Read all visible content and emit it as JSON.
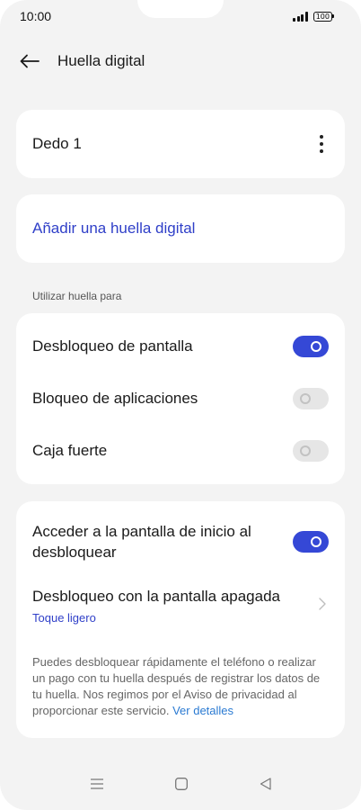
{
  "status_bar": {
    "time": "10:00",
    "battery": "100"
  },
  "header": {
    "title": "Huella digital"
  },
  "finger": {
    "label": "Dedo 1"
  },
  "add": {
    "label": "Añadir una huella digital"
  },
  "use_section": {
    "label": "Utilizar huella para",
    "items": [
      {
        "label": "Desbloqueo de pantalla",
        "state": "on"
      },
      {
        "label": "Bloqueo de aplicaciones",
        "state": "off"
      },
      {
        "label": "Caja fuerte",
        "state": "off"
      }
    ]
  },
  "more_section": {
    "home_unlock": {
      "label": "Acceder a la pantalla de inicio al desbloquear",
      "state": "on"
    },
    "screen_off": {
      "title": "Desbloqueo con la pantalla apagada",
      "value": "Toque ligero"
    },
    "info": "Puedes desbloquear rápidamente el teléfono o realizar un pago con tu huella después de registrar los datos de tu huella. Nos regimos por el Aviso de privacidad al proporcionar este servicio.",
    "info_link": "Ver detalles"
  },
  "colors": {
    "accent": "#3548d6",
    "link": "#2f3fc8",
    "info_link": "#2a7ad2",
    "background": "#f3f3f3"
  }
}
